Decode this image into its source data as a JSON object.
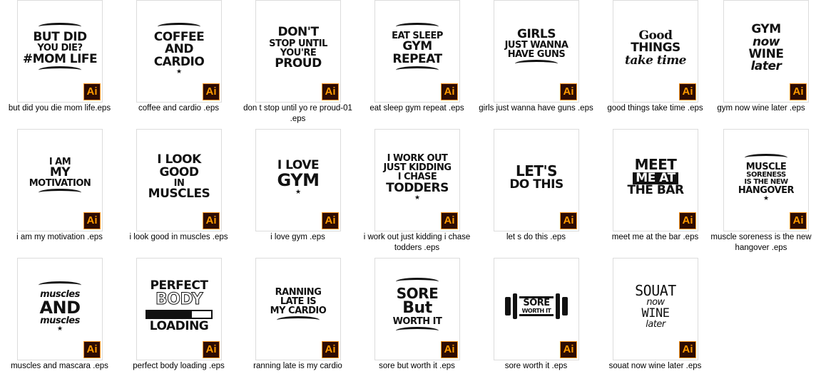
{
  "badge_text": "Ai",
  "colors": {
    "badge_bg": "#2c0b02",
    "badge_border": "#f7951d",
    "badge_text": "#ff9a00",
    "thumb_border": "#dcdcdc"
  },
  "files": [
    {
      "name": "but did you die mom life.eps",
      "art": [
        "BUT DID",
        "YOU DIE?",
        "#MOM LIFE"
      ]
    },
    {
      "name": "coffee and cardio .eps",
      "art": [
        "COFFEE",
        "AND",
        "CARDIO"
      ]
    },
    {
      "name": "don t stop until yo re proud-01 .eps",
      "art": [
        "DON'T",
        "STOP UNTIL",
        "YOU'RE",
        "PROUD"
      ]
    },
    {
      "name": "eat sleep gym repeat .eps",
      "art": [
        "EAT SLEEP",
        "GYM",
        "REPEAT"
      ]
    },
    {
      "name": "girls just wanna have guns .eps",
      "art": [
        "girls",
        "JUST WANNA",
        "HAVE GUNS"
      ]
    },
    {
      "name": "good things take time .eps",
      "art": [
        "Good",
        "THINGS",
        "take time"
      ]
    },
    {
      "name": "gym now wine later .eps",
      "art": [
        "GYM",
        "now",
        "WINE",
        "later"
      ]
    },
    {
      "name": "i am my motivation .eps",
      "art": [
        "I AM",
        "MY",
        "MOTIVATION"
      ]
    },
    {
      "name": "i look good in muscles .eps",
      "art": [
        "I LOOK",
        "GOOD",
        "IN",
        "MUSCLES"
      ]
    },
    {
      "name": "i love gym .eps",
      "art": [
        "I LOVE",
        "GYM"
      ]
    },
    {
      "name": "i work out just kidding i chase todders .eps",
      "art": [
        "I WORK OUT",
        "JUST KIDDING",
        "I CHASE",
        "TODDERS"
      ]
    },
    {
      "name": "let s do this .eps",
      "art": [
        "LET'S",
        "DO THIS"
      ]
    },
    {
      "name": "meet me at the bar .eps",
      "art": [
        "MEET",
        "ME AT",
        "THE BAR"
      ]
    },
    {
      "name": "muscle soreness is the new hangover .eps",
      "art": [
        "MUSCLE",
        "SORENESS",
        "IS THE NEW",
        "HANGOVER"
      ]
    },
    {
      "name": "muscles and mascara .eps",
      "art": [
        "muscles",
        "AND",
        "muscles"
      ]
    },
    {
      "name": "perfect body loading .eps",
      "art": [
        "PERFECT",
        "BODY",
        "LOADING"
      ]
    },
    {
      "name": "ranning late is my cardio",
      "art": [
        "RANNING",
        "LATE IS",
        "MY CARDIO"
      ]
    },
    {
      "name": "sore but worth it .eps",
      "art": [
        "SORE",
        "But",
        "WORTH IT"
      ]
    },
    {
      "name": "sore worth it .eps",
      "art": [
        "SORE",
        "WORTH IT"
      ]
    },
    {
      "name": "souat now wine later .eps",
      "art": [
        "SOUAT",
        "now",
        "WINE",
        "later"
      ]
    }
  ]
}
